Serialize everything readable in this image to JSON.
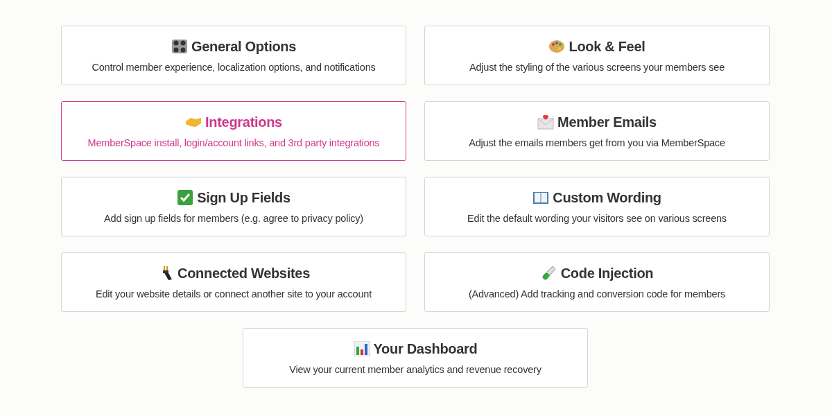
{
  "cards": [
    {
      "title": "General Options",
      "description": "Control member experience, localization options, and notifications",
      "selected": false
    },
    {
      "title": "Look & Feel",
      "description": "Adjust the styling of the various screens your members see",
      "selected": false
    },
    {
      "title": "Integrations",
      "description": "MemberSpace install, login/account links, and 3rd party integrations",
      "selected": true
    },
    {
      "title": "Member Emails",
      "description": "Adjust the emails members get from you via MemberSpace",
      "selected": false
    },
    {
      "title": "Sign Up Fields",
      "description": "Add sign up fields for members (e.g. agree to privacy policy)",
      "selected": false
    },
    {
      "title": "Custom Wording",
      "description": "Edit the default wording your visitors see on various screens",
      "selected": false
    },
    {
      "title": "Connected Websites",
      "description": "Edit your website details or connect another site to your account",
      "selected": false
    },
    {
      "title": "Code Injection",
      "description": "(Advanced) Add tracking and conversion code for members",
      "selected": false
    },
    {
      "title": "Your Dashboard",
      "description": "View your current member analytics and revenue recovery",
      "selected": false
    }
  ]
}
